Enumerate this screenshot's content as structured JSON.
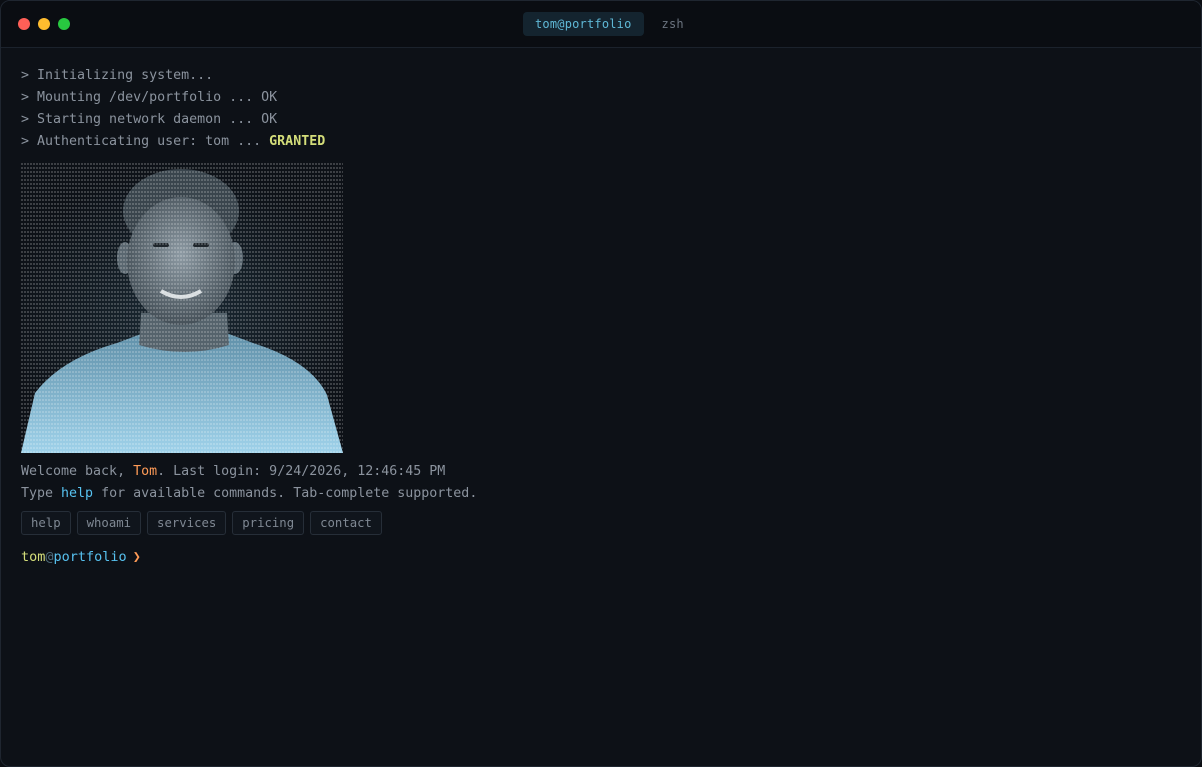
{
  "window": {
    "tabs": [
      {
        "label": "tom@portfolio",
        "active": true
      },
      {
        "label": "zsh",
        "active": false
      }
    ]
  },
  "boot": {
    "lines": [
      "> Initializing system...",
      "> Mounting /dev/portfolio ... OK",
      "> Starting network daemon ... OK"
    ],
    "auth_prefix": "> Authenticating user: tom ... ",
    "auth_status": "GRANTED"
  },
  "welcome": {
    "prefix": "Welcome back, ",
    "name": "Tom",
    "last_login": ". Last login: 9/24/2026, 12:46:45 PM"
  },
  "hint": {
    "prefix": "Type ",
    "command": "help",
    "suffix": " for available commands. Tab-complete supported."
  },
  "commands": [
    "help",
    "whoami",
    "services",
    "pricing",
    "contact"
  ],
  "prompt": {
    "user": "tom",
    "at": "@",
    "host": "portfolio",
    "symbol": "❯"
  },
  "colors": {
    "background": "#0d1117",
    "accent_cyan": "#57c2f0",
    "accent_orange": "#ff9b57",
    "accent_yellow": "#d4de7a"
  }
}
